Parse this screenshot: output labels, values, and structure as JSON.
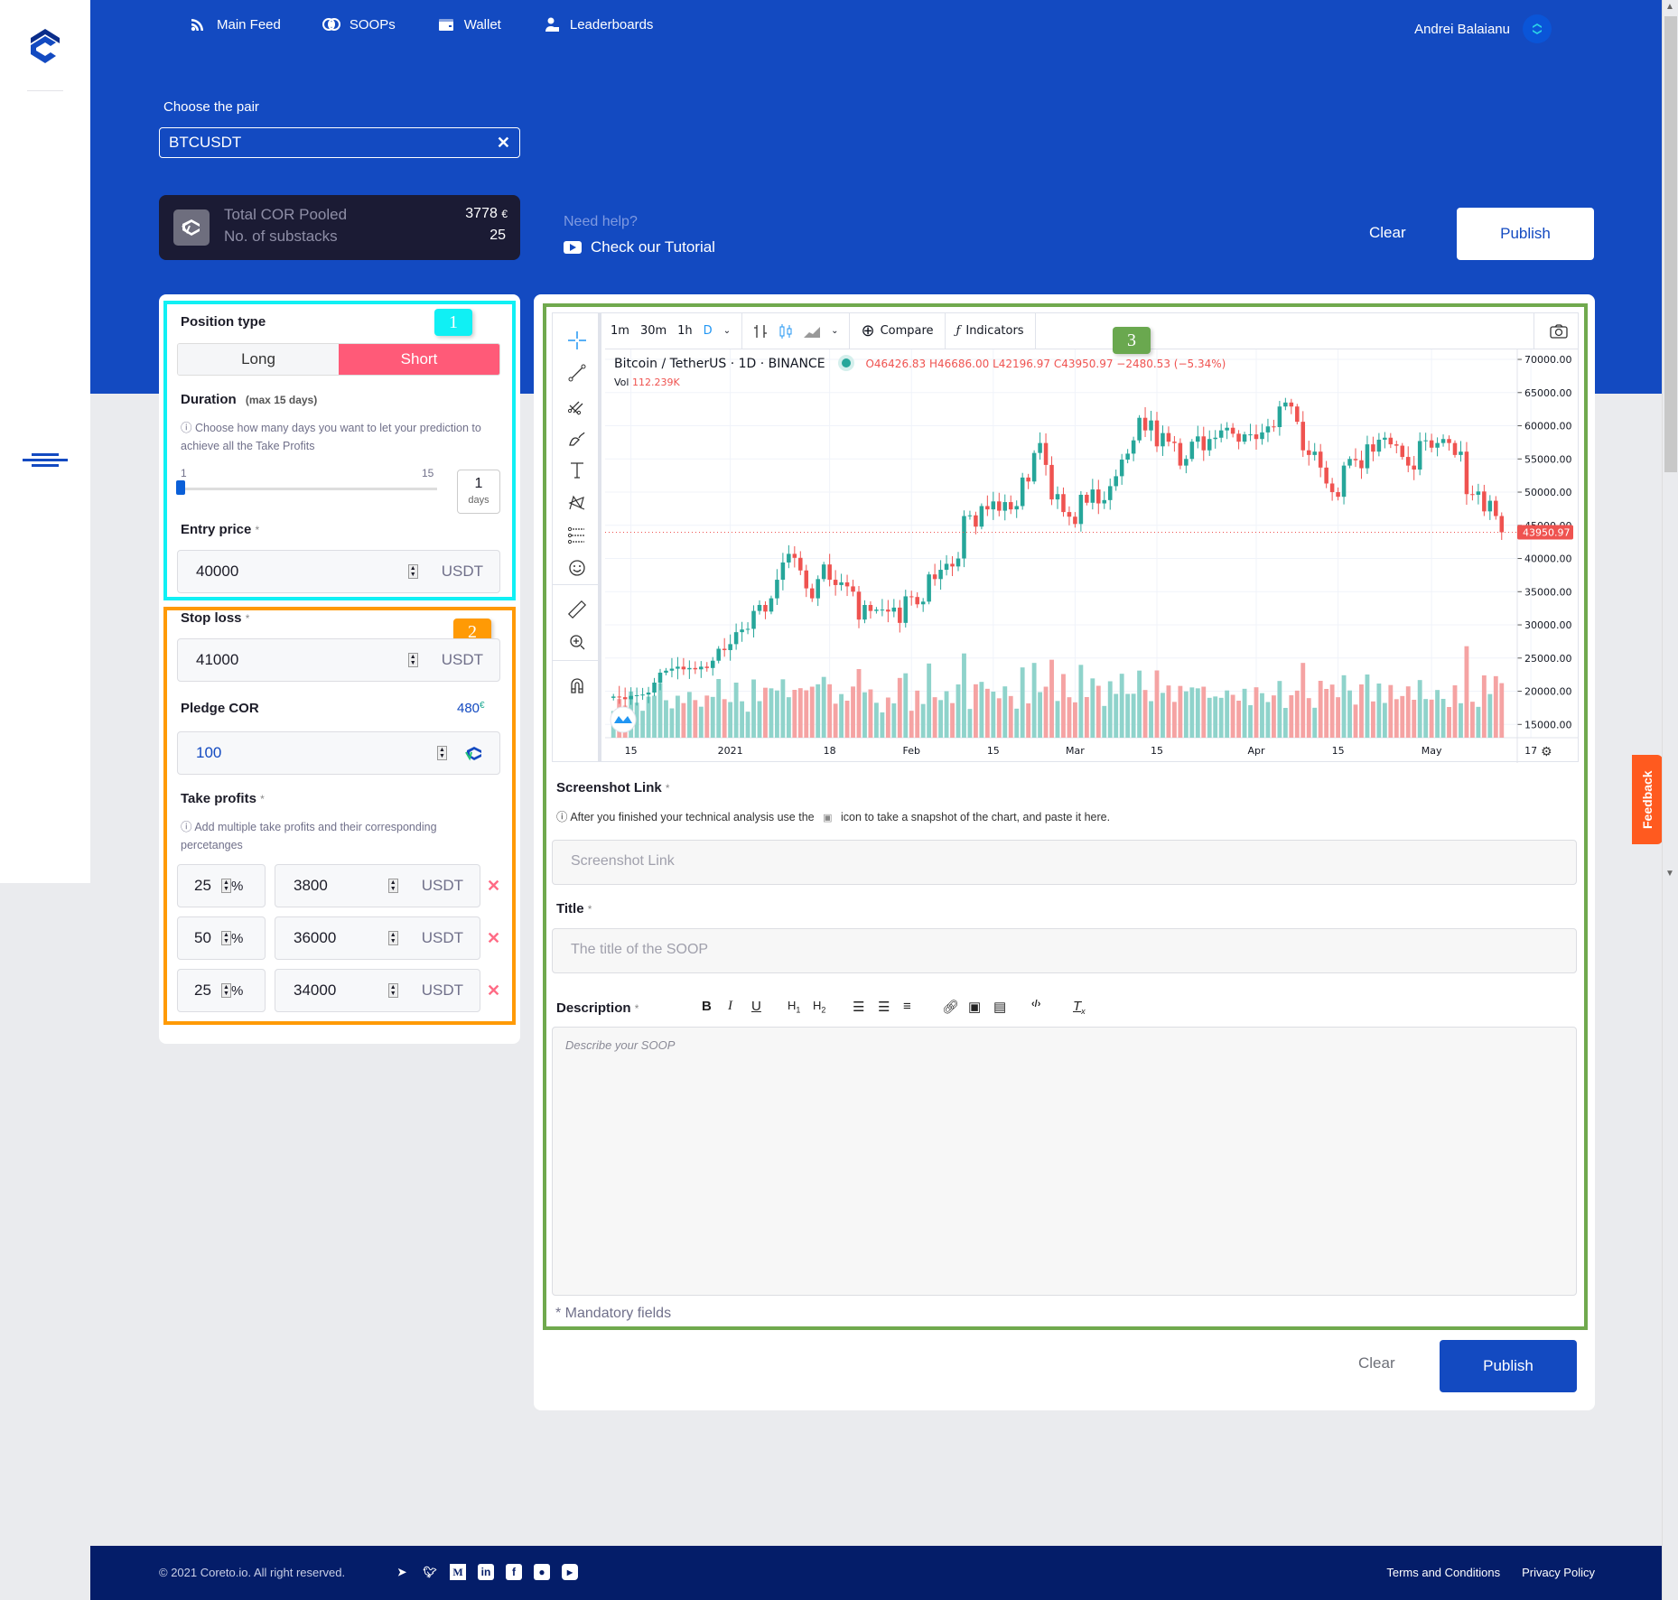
{
  "nav": {
    "items": [
      {
        "label": "Main Feed",
        "icon": "rss-icon"
      },
      {
        "label": "SOOPs",
        "icon": "soops-icon"
      },
      {
        "label": "Wallet",
        "icon": "wallet-icon"
      },
      {
        "label": "Leaderboards",
        "icon": "leaderboard-icon"
      }
    ],
    "user_name": "Andrei Balaianu"
  },
  "pair": {
    "label": "Choose the pair",
    "value": "BTCUSDT",
    "clear_icon": "✕"
  },
  "pool": {
    "total_label": "Total COR Pooled",
    "total_value": "3778",
    "substacks_label": "No. of substacks",
    "substacks_value": "25"
  },
  "help": {
    "question": "Need help?",
    "tutorial_link": "Check our Tutorial"
  },
  "actions": {
    "clear": "Clear",
    "publish": "Publish"
  },
  "badges": {
    "one": "1",
    "two": "2",
    "three": "3"
  },
  "form": {
    "position_type": {
      "label": "Position type",
      "options": [
        "Long",
        "Short"
      ],
      "selected": "Short"
    },
    "duration": {
      "label": "Duration",
      "hint": "(max 15 days)",
      "note": "Choose how many days you want to let your prediction to achieve all the Take Profits",
      "min": "1",
      "max": "15",
      "value": "1",
      "unit": "days",
      "slider_fraction": 0
    },
    "entry_price": {
      "label": "Entry price",
      "required": "*",
      "value": "40000",
      "unit": "USDT"
    },
    "stop_loss": {
      "label": "Stop loss",
      "required": "*",
      "value": "41000",
      "unit": "USDT"
    },
    "pledge": {
      "label": "Pledge COR",
      "available": "480",
      "value": "100"
    },
    "take_profits": {
      "label": "Take profits",
      "required": "*",
      "note": "Add multiple take profits and their corresponding percetanges",
      "rows": [
        {
          "percent": "25",
          "price": "3800",
          "unit": "USDT"
        },
        {
          "percent": "50",
          "price": "36000",
          "unit": "USDT"
        },
        {
          "percent": "25",
          "price": "34000",
          "unit": "USDT"
        }
      ],
      "percent_sign": "%"
    }
  },
  "chart": {
    "intervals": [
      "1m",
      "30m",
      "1h",
      "D"
    ],
    "active_interval": "D",
    "compare": "Compare",
    "indicators": "Indicators",
    "symbol": "Bitcoin / TetherUS · 1D · BINANCE",
    "ohlc": "O46426.83 H46686.00 L42196.97 C43950.97 −2480.53 (−5.34%)",
    "vol_label": "Vol",
    "vol_value": "112.239K",
    "last_price": "43950.97",
    "colors": {
      "up": "#26a69a",
      "down": "#ef5350",
      "up_vol": "#8fd3cb",
      "down_vol": "#f5a3a3"
    }
  },
  "chart_data": {
    "type": "candlestick",
    "title": "Bitcoin / TetherUS · 1D · BINANCE",
    "y_ticks": [
      "70000.00",
      "65000.00",
      "60000.00",
      "55000.00",
      "50000.00",
      "45000.00",
      "40000.00",
      "35000.00",
      "30000.00",
      "25000.00",
      "20000.00",
      "15000.00"
    ],
    "ylim": [
      13000,
      71500
    ],
    "x_ticks": [
      {
        "label": "15",
        "index": 3
      },
      {
        "label": "2021",
        "index": 20
      },
      {
        "label": "18",
        "index": 37
      },
      {
        "label": "Feb",
        "index": 51
      },
      {
        "label": "15",
        "index": 65
      },
      {
        "label": "Mar",
        "index": 79
      },
      {
        "label": "15",
        "index": 93
      },
      {
        "label": "Apr",
        "index": 110
      },
      {
        "label": "15",
        "index": 124
      },
      {
        "label": "May",
        "index": 140
      },
      {
        "label": "17",
        "index": 157
      }
    ],
    "closes": [
      19200,
      19100,
      18800,
      19300,
      19400,
      19500,
      19800,
      21300,
      22800,
      23100,
      23400,
      23700,
      23300,
      23500,
      23300,
      23700,
      23500,
      24600,
      26400,
      26200,
      27100,
      28900,
      29300,
      29400,
      32100,
      33000,
      32000,
      34000,
      36800,
      39400,
      40700,
      40100,
      38200,
      35500,
      34000,
      36900,
      39100,
      36800,
      36000,
      36400,
      35800,
      35000,
      30800,
      33000,
      32100,
      32300,
      32300,
      32000,
      32600,
      30300,
      34300,
      34200,
      33100,
      33500,
      37600,
      36900,
      38300,
      39200,
      38800,
      40000,
      46400,
      46500,
      44800,
      47900,
      47400,
      48600,
      47200,
      48500,
      47400,
      47900,
      52200,
      51600,
      55900,
      57400,
      54100,
      48900,
      49700,
      47000,
      46300,
      45200,
      49600,
      48400,
      50400,
      48300,
      48800,
      50900,
      52400,
      54900,
      55800,
      57800,
      61200,
      59300,
      60800,
      56900,
      58900,
      57600,
      57400,
      54000,
      55000,
      57600,
      58400,
      56300,
      58000,
      58200,
      59300,
      59700,
      58800,
      57600,
      58700,
      58700,
      58000,
      59000,
      59900,
      59800,
      62900,
      63500,
      62900,
      60600,
      56300,
      55600,
      56100,
      53700,
      51300,
      50000,
      49300,
      54000,
      55000,
      54800,
      53600,
      57200,
      56100,
      57900,
      58200,
      57200,
      57000,
      55300,
      54000,
      53400,
      57700,
      57800,
      56700,
      57400,
      58000,
      57400,
      55600,
      56100,
      49700,
      49600,
      50100,
      47100,
      48700,
      46400,
      43950
    ],
    "volume_note": "Volume histogram below price, colored by candle direction"
  },
  "screenshot": {
    "label": "Screenshot Link",
    "required": "*",
    "note_before": "After you finished your technical analysis use the",
    "note_after": "icon to take a snapshot of the chart, and paste it here.",
    "placeholder": "Screenshot Link"
  },
  "title_field": {
    "label": "Title",
    "required": "*",
    "placeholder": "The title of the SOOP"
  },
  "description": {
    "label": "Description",
    "required": "*",
    "placeholder": "Describe your SOOP",
    "toolbar": [
      "B",
      "I",
      "U",
      "H1",
      "H2",
      "ordered-list",
      "bullet-list",
      "align",
      "link",
      "image",
      "video",
      "code",
      "clear-format"
    ]
  },
  "mandatory_note": "* Mandatory fields",
  "feedback": "Feedback",
  "footer": {
    "copyright": "© 2021 Coreto.io. All right reserved.",
    "social": [
      "telegram",
      "twitter",
      "medium",
      "linkedin",
      "facebook",
      "reddit",
      "youtube"
    ],
    "terms": "Terms and Conditions",
    "privacy": "Privacy Policy"
  }
}
